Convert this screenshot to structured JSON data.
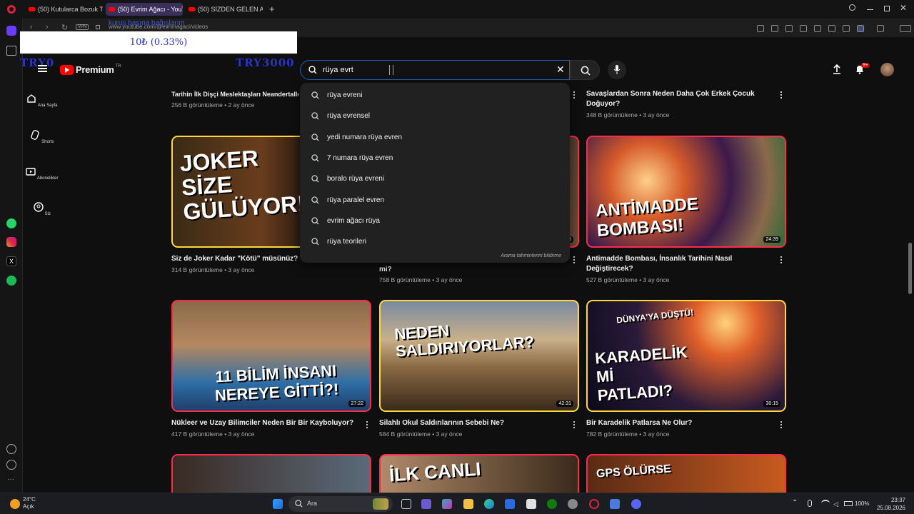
{
  "browser": {
    "tabs": [
      {
        "label": "(50) Kutularca Bozuk Tavu..."
      },
      {
        "label": "(50) Evrim Ağacı - YouTub..."
      },
      {
        "label": "(50) SİZDEN GELEN ANILA..."
      }
    ],
    "url": "www.youtube.com/@evrimagaci/videos"
  },
  "overlay": {
    "blurb": "kuruş başına bağışlarım",
    "price": "10₺ (0.33%)",
    "left_label": "TRY0",
    "right_label": "TRY3000"
  },
  "youtube": {
    "logo_text": "Premium",
    "logo_region": "TR",
    "search_query": "rüya evrt",
    "notification_count": "9+",
    "guide": [
      {
        "label": "Ana Sayfa",
        "icon": "home-icon"
      },
      {
        "label": "Shorts",
        "icon": "shorts-icon"
      },
      {
        "label": "Abonelikler",
        "icon": "subscriptions-icon"
      },
      {
        "label": "Siz",
        "icon": "user-icon"
      }
    ],
    "suggestions": [
      "rüya evreni",
      "rüya evrensel",
      "yedi numara rüya evren",
      "7 numara rüya evren",
      "boralo rüya evreni",
      "rüya paralel evren",
      "evrim ağacı rüya",
      "rüya teorileri"
    ],
    "suggestions_report": "Arama tahminlerini bildirme",
    "top_row": [
      {
        "title": "Tarihin İlk Dişçi Meslektaşları Neandertaller Olabilir",
        "meta": "256 B görüntüleme • 2 ay önce"
      },
      {
        "title": "Savaşlardan Sonra Neden Daha Çok Erkek Çocuk Doğuyor?",
        "meta": "348 B görüntüleme • 3 ay önce"
      }
    ],
    "row2": [
      {
        "title": "Siz de Joker Kadar \"Kötü\" müsünüz?",
        "meta": "314 B görüntüleme • 3 ay önce",
        "thumb_text": "JOKER SİZE GÜLÜYOR!",
        "duration": ""
      },
      {
        "title": "mi?",
        "meta": "758 B görüntüleme • 3 ay önce",
        "thumb_text": "",
        "duration": "6"
      },
      {
        "title": "Antimadde Bombası, İnsanlık Tarihini Nasıl Değiştirecek?",
        "meta": "527 B görüntüleme • 3 ay önce",
        "thumb_text": "ANTİMADDE BOMBASI!",
        "duration": "24:39"
      }
    ],
    "row3": [
      {
        "title": "Nükleer ve Uzay Bilimciler Neden Bir Bir Kayboluyor?",
        "meta": "417 B görüntüleme • 3 ay önce",
        "thumb_text": "11 BİLİM İNSANI NEREYE GİTTİ?!",
        "duration": "27:22"
      },
      {
        "title": "Silahlı Okul Saldırılarının Sebebi Ne?",
        "meta": "584 B görüntüleme • 3 ay önce",
        "thumb_text": "NEDEN SALDIRIYORLAR?",
        "duration": "42:31"
      },
      {
        "title": "Bir Karadelik Patlarsa Ne Olur?",
        "meta": "782 B görüntüleme • 3 ay önce",
        "thumb_text": "KARADELİK Mİ PATLADI?",
        "thumb_top": "DÜNYA'YA DÜŞTÜ!",
        "duration": "30:15"
      }
    ],
    "row4": [
      {
        "thumb_text": ""
      },
      {
        "thumb_text": "İLK CANLI"
      },
      {
        "thumb_text": "GPS ÖLÜRSE"
      }
    ]
  },
  "taskbar": {
    "weather_temp": "24°C",
    "weather_desc": "Açık",
    "search_label": "Ara",
    "battery": "100%",
    "time": "23:37",
    "date": "25.08.2026"
  },
  "colors": {
    "accent_red": "#ff0000",
    "thumb_border_red": "#ff2a4a",
    "thumb_border_yellow": "#ffd93b",
    "overlay_blue": "#2b34c8"
  }
}
